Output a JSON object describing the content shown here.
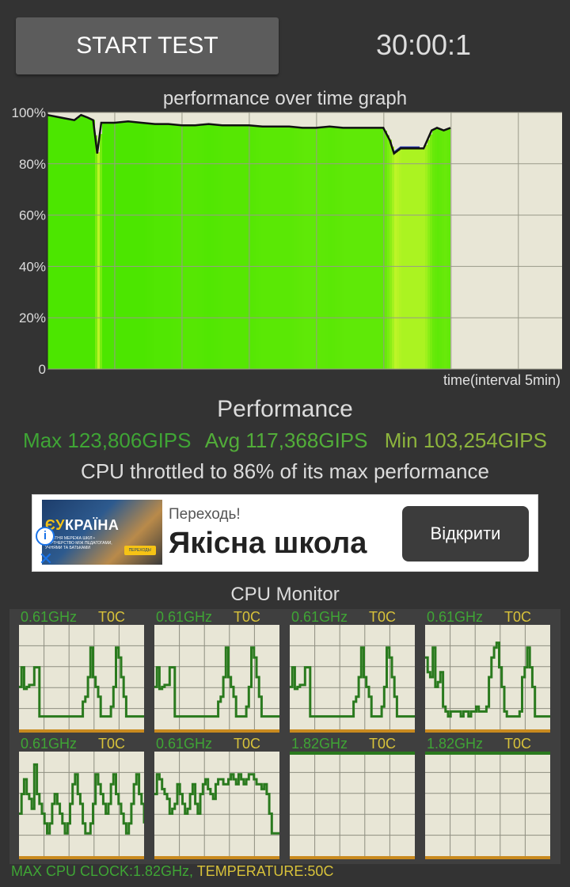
{
  "header": {
    "start_label": "START TEST",
    "timer": "30:00:1"
  },
  "graph": {
    "title": "performance over time graph",
    "y_ticks": [
      "100%",
      "80%",
      "60%",
      "40%",
      "20%",
      "0"
    ],
    "x_label": "time(interval 5min)"
  },
  "chart_data": [
    {
      "type": "area",
      "title": "performance over time graph",
      "xlabel": "time(interval 5min)",
      "ylabel": "",
      "ylim": [
        0,
        100
      ],
      "x_unit": "minutes",
      "x": [
        0,
        1,
        2,
        2.5,
        3,
        3.4,
        3.7,
        4,
        5,
        6,
        7,
        8,
        9,
        10,
        11,
        12,
        13,
        14,
        15,
        16,
        17,
        18,
        19,
        20,
        21,
        22,
        23,
        24,
        25,
        25.5,
        25.8,
        26.3,
        27,
        27.7,
        28,
        28.6,
        29,
        29.5,
        30
      ],
      "series": [
        {
          "values": [
            99,
            98,
            97,
            99,
            98,
            97,
            84,
            96,
            96,
            96.5,
            96,
            95.5,
            95.5,
            95,
            95,
            95.5,
            95,
            95,
            95,
            94.5,
            94.5,
            94.5,
            94,
            94,
            94.5,
            94,
            94,
            94,
            94,
            89,
            84,
            86,
            86,
            86,
            86,
            93,
            94,
            93,
            94
          ]
        }
      ],
      "grid": true,
      "colors": {
        "area_high": "#4ce600",
        "area_low": "#b8f52a",
        "line": "#111111",
        "empty_region": "#e8e6d6"
      }
    },
    {
      "type": "line",
      "title": "CPU Monitor",
      "grid": true,
      "ylim": [
        0,
        100
      ],
      "series": [
        {
          "values": [
            40,
            60,
            38,
            40,
            42,
            42,
            60,
            60,
            10,
            10,
            10,
            10,
            10,
            10,
            10,
            10,
            10,
            10,
            10,
            10,
            10,
            10,
            10,
            10,
            10,
            25,
            30,
            50,
            80,
            50,
            40,
            30,
            10,
            10,
            10,
            10,
            20,
            40,
            80,
            70,
            50,
            30,
            10,
            10,
            10,
            10,
            10,
            10,
            10,
            10
          ]
        },
        {
          "values": [
            40,
            60,
            38,
            40,
            42,
            42,
            60,
            60,
            10,
            10,
            10,
            10,
            10,
            10,
            10,
            10,
            10,
            10,
            10,
            10,
            10,
            10,
            10,
            10,
            10,
            25,
            30,
            50,
            80,
            50,
            40,
            30,
            10,
            10,
            10,
            10,
            20,
            40,
            80,
            70,
            50,
            30,
            10,
            10,
            10,
            10,
            10,
            10,
            10,
            10
          ]
        },
        {
          "values": [
            40,
            60,
            38,
            40,
            42,
            42,
            60,
            60,
            10,
            10,
            10,
            10,
            10,
            10,
            10,
            10,
            10,
            10,
            10,
            10,
            10,
            10,
            10,
            10,
            10,
            25,
            30,
            50,
            80,
            50,
            40,
            30,
            10,
            10,
            10,
            10,
            20,
            40,
            80,
            70,
            50,
            30,
            10,
            10,
            10,
            10,
            10,
            10,
            10,
            10
          ]
        },
        {
          "values": [
            70,
            55,
            50,
            80,
            40,
            45,
            55,
            20,
            15,
            10,
            15,
            15,
            15,
            15,
            10,
            15,
            15,
            10,
            15,
            15,
            20,
            15,
            15,
            15,
            20,
            50,
            70,
            80,
            85,
            60,
            40,
            15,
            10,
            10,
            10,
            10,
            10,
            15,
            50,
            60,
            80,
            60,
            40,
            10,
            10,
            10,
            10,
            10,
            10,
            10
          ]
        },
        {
          "values": [
            40,
            60,
            75,
            60,
            55,
            45,
            90,
            60,
            50,
            40,
            30,
            20,
            30,
            50,
            60,
            50,
            40,
            30,
            20,
            30,
            50,
            70,
            80,
            60,
            50,
            30,
            20,
            20,
            30,
            50,
            80,
            70,
            60,
            50,
            40,
            50,
            70,
            80,
            60,
            50,
            40,
            30,
            20,
            30,
            50,
            70,
            80,
            60,
            50,
            30
          ]
        },
        {
          "values": [
            60,
            80,
            75,
            65,
            60,
            55,
            40,
            45,
            50,
            70,
            60,
            50,
            40,
            45,
            60,
            70,
            50,
            40,
            60,
            70,
            75,
            65,
            60,
            55,
            70,
            75,
            75,
            70,
            70,
            75,
            80,
            75,
            70,
            80,
            75,
            70,
            75,
            80,
            80,
            75,
            70,
            70,
            65,
            70,
            60,
            40,
            20,
            20,
            20,
            20
          ]
        },
        {
          "values": [
            100
          ]
        },
        {
          "values": [
            100
          ]
        }
      ]
    }
  ],
  "summary": {
    "heading": "Performance",
    "max": "Max 123,806GIPS",
    "avg": "Avg 117,368GIPS",
    "min": "Min 103,254GIPS",
    "throttle": "CPU throttled to 86% of its max performance"
  },
  "ad": {
    "image_logo_prefix": "ЄУ",
    "image_logo_rest": "КРАЇНА",
    "image_caption": "ОСВІТНЯ МЕРЕЖА ШКІЛ • ПАРТНЕРСТВО МІЖ ПЕДАГОГАМИ, УЧНЯМИ ТА БАТЬКАМИ",
    "image_cta": "ПЕРЕХОДЬ!",
    "info_icon": "ⓘ",
    "close_icon": "✕",
    "kicker": "Переходь!",
    "headline": "Якісна школа",
    "button": "Відкрити"
  },
  "cpu_monitor": {
    "title": "CPU Monitor",
    "cores": [
      {
        "freq": "0.61GHz",
        "temp": "T0C"
      },
      {
        "freq": "0.61GHz",
        "temp": "T0C"
      },
      {
        "freq": "0.61GHz",
        "temp": "T0C"
      },
      {
        "freq": "0.61GHz",
        "temp": "T0C"
      },
      {
        "freq": "0.61GHz",
        "temp": "T0C"
      },
      {
        "freq": "0.61GHz",
        "temp": "T0C"
      },
      {
        "freq": "1.82GHz",
        "temp": "T0C"
      },
      {
        "freq": "1.82GHz",
        "temp": "T0C"
      }
    ]
  },
  "footer": {
    "clock": "MAX CPU CLOCK:1.82GHz,",
    "temperature": "TEMPERATURE:50C"
  }
}
